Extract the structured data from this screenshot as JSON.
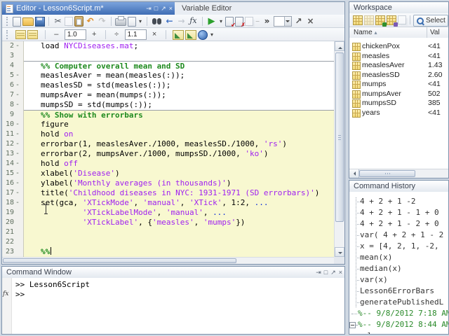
{
  "editor": {
    "title": "Editor - Lesson6Script.m*",
    "variable_editor_tab": "Variable Editor",
    "titlebar_icons": [
      {
        "name": "dock-icon",
        "glyph": "⇥"
      },
      {
        "name": "maximize-icon",
        "glyph": "□"
      },
      {
        "name": "undock-icon",
        "glyph": "↗"
      },
      {
        "name": "close-icon",
        "glyph": "×"
      }
    ],
    "toolbar_main": [
      {
        "name": "new-script-icon",
        "cls": "i-page"
      },
      {
        "name": "open-file-icon",
        "cls": "i-folder"
      },
      {
        "name": "save-icon",
        "cls": "i-disk"
      },
      {
        "name": "sep"
      },
      {
        "name": "cut-icon",
        "cls": "i-glyph",
        "glyph": "✂",
        "color": "#5a6068"
      },
      {
        "name": "copy-icon",
        "cls": "i-copy i-dim"
      },
      {
        "name": "paste-icon",
        "cls": "i-paste"
      },
      {
        "name": "undo-icon",
        "cls": "i-glyph",
        "glyph": "↶",
        "color": "#e08a1e"
      },
      {
        "name": "redo-icon",
        "cls": "i-glyph i-dim",
        "glyph": "↷",
        "color": "#888"
      },
      {
        "name": "sep"
      },
      {
        "name": "print-icon",
        "cls": "i-printer"
      },
      {
        "name": "print-preview-icon",
        "cls": "i-page"
      },
      {
        "name": "print-dropdown-icon",
        "cls": "i-glyph i-tiny",
        "glyph": "▾",
        "color": "#444"
      },
      {
        "name": "sep"
      },
      {
        "name": "find-icon",
        "cls": "i-binoc"
      },
      {
        "name": "go-back-icon",
        "cls": "i-glyph",
        "glyph": "←",
        "color": "#3b6fc4"
      },
      {
        "name": "go-forward-icon",
        "cls": "i-glyph i-dim",
        "glyph": "→",
        "color": "#8a94a2"
      },
      {
        "name": "insert-function-icon",
        "cls": "i-fx",
        "glyph": "ƒx",
        "color": "#3a4450"
      },
      {
        "name": "sep"
      },
      {
        "name": "run-icon",
        "cls": "i-run",
        "glyph": "▶",
        "color": "#2ca02c"
      },
      {
        "name": "run-dropdown-icon",
        "cls": "i-glyph i-tiny",
        "glyph": "▾",
        "color": "#444"
      },
      {
        "name": "save-and-run-icon",
        "cls": "i-page",
        "mark": "↙",
        "markcolor": "#c00"
      },
      {
        "name": "save-run-close-icon",
        "cls": "i-page",
        "mark": "✗",
        "markcolor": "#c00"
      },
      {
        "name": "run-configurations-icon",
        "cls": "i-copy i-dim"
      },
      {
        "name": "collapse-toolbar-icon",
        "cls": "i-glyph i-tiny i-dim",
        "glyph": "−",
        "color": "#777"
      },
      {
        "name": "overflow-chevron-icon",
        "cls": "i-glyph",
        "glyph": "»",
        "color": "#333"
      },
      {
        "name": "document-combo-box",
        "cls": "i-combo"
      },
      {
        "name": "undock-icon",
        "cls": "i-glyph",
        "glyph": "↗",
        "color": "#555"
      },
      {
        "name": "close-icon",
        "cls": "i-glyph",
        "glyph": "×",
        "color": "#555"
      }
    ],
    "toolbar_cell": {
      "icons_left": [
        {
          "name": "insert-cell-break-icon",
          "cls": "i-cell"
        },
        {
          "name": "next-cell-icon",
          "cls": "i-cell"
        }
      ],
      "decrement_label": "–",
      "add_value": "1.0",
      "increment_label": "+",
      "divide_label": "÷",
      "multiply_value": "1.1",
      "multiply_label": "×",
      "icons_right": [
        {
          "name": "evaluate-cell-icon",
          "cls": "i-chart"
        },
        {
          "name": "evaluate-cell-advance-icon",
          "cls": "i-chart"
        },
        {
          "name": "publish-icon",
          "cls": "i-info"
        },
        {
          "name": "publish-dropdown-icon",
          "cls": "i-glyph i-tiny",
          "glyph": "▾",
          "color": "#444"
        }
      ]
    },
    "code_lines": [
      {
        "n": "2",
        "x": 1,
        "c": 0,
        "d": 0,
        "s": [
          [
            "load ",
            "d"
          ],
          [
            "NYCDiseases.mat",
            "s"
          ],
          [
            ";",
            "d"
          ]
        ]
      },
      {
        "n": "3",
        "x": 0,
        "c": 0,
        "d": 0,
        "s": []
      },
      {
        "n": "4",
        "x": 0,
        "c": 0,
        "d": 1,
        "s": [
          [
            "%% Computer overall mean and SD",
            "c"
          ]
        ]
      },
      {
        "n": "5",
        "x": 1,
        "c": 0,
        "d": 0,
        "s": [
          [
            "measlesAver = mean(measles(:));",
            "d"
          ]
        ]
      },
      {
        "n": "6",
        "x": 1,
        "c": 0,
        "d": 0,
        "s": [
          [
            "measlesSD = std(measles(:));",
            "d"
          ]
        ]
      },
      {
        "n": "7",
        "x": 1,
        "c": 0,
        "d": 0,
        "s": [
          [
            "mumpsAver = mean(mumps(:));",
            "d"
          ]
        ]
      },
      {
        "n": "8",
        "x": 1,
        "c": 0,
        "d": 0,
        "s": [
          [
            "mumpsSD = std(mumps(:));",
            "d"
          ]
        ]
      },
      {
        "n": "9",
        "x": 0,
        "c": 1,
        "d": 1,
        "s": [
          [
            "%% Show with errorbars",
            "c"
          ]
        ]
      },
      {
        "n": "10",
        "x": 1,
        "c": 1,
        "d": 0,
        "s": [
          [
            "figure",
            "d"
          ]
        ]
      },
      {
        "n": "11",
        "x": 1,
        "c": 1,
        "d": 0,
        "s": [
          [
            "hold ",
            "d"
          ],
          [
            "on",
            "s"
          ]
        ]
      },
      {
        "n": "12",
        "x": 1,
        "c": 1,
        "d": 0,
        "s": [
          [
            "errorbar(1, measlesAver./1000, measlesSD./1000, ",
            "d"
          ],
          [
            "'rs'",
            "s"
          ],
          [
            ")",
            "d"
          ]
        ]
      },
      {
        "n": "13",
        "x": 1,
        "c": 1,
        "d": 0,
        "s": [
          [
            "errorbar(2, mumpsAver./1000, mumpsSD./1000, ",
            "d"
          ],
          [
            "'ko'",
            "s"
          ],
          [
            ")",
            "d"
          ]
        ]
      },
      {
        "n": "14",
        "x": 1,
        "c": 1,
        "d": 0,
        "s": [
          [
            "hold ",
            "d"
          ],
          [
            "off",
            "s"
          ]
        ]
      },
      {
        "n": "15",
        "x": 1,
        "c": 1,
        "d": 0,
        "s": [
          [
            "xlabel(",
            "d"
          ],
          [
            "'Disease'",
            "s"
          ],
          [
            ")",
            "d"
          ]
        ]
      },
      {
        "n": "16",
        "x": 1,
        "c": 1,
        "d": 0,
        "s": [
          [
            "ylabel(",
            "d"
          ],
          [
            "'Monthly averages (in thousands)'",
            "s"
          ],
          [
            ")",
            "d"
          ]
        ]
      },
      {
        "n": "17",
        "x": 1,
        "c": 1,
        "d": 0,
        "s": [
          [
            "title(",
            "d"
          ],
          [
            "'Childhood diseases in NYC: 1931-1971 (SD errorbars)'",
            "s"
          ],
          [
            ")",
            "d"
          ]
        ]
      },
      {
        "n": "18",
        "x": 1,
        "c": 1,
        "d": 0,
        "s": [
          [
            "set(gca, ",
            "d"
          ],
          [
            "'XTickMode'",
            "s"
          ],
          [
            ", ",
            "d"
          ],
          [
            "'manual'",
            "s"
          ],
          [
            ", ",
            "d"
          ],
          [
            "'XTick'",
            "s"
          ],
          [
            ", 1:2, ",
            "d"
          ],
          [
            "...",
            "k"
          ]
        ]
      },
      {
        "n": "19",
        "x": 0,
        "c": 1,
        "d": 0,
        "s": [
          [
            "         ",
            "d"
          ],
          [
            "'XTickLabelMode'",
            "s"
          ],
          [
            ", ",
            "d"
          ],
          [
            "'manual'",
            "s"
          ],
          [
            ", ",
            "d"
          ],
          [
            "...",
            "k"
          ]
        ]
      },
      {
        "n": "20",
        "x": 0,
        "c": 1,
        "d": 0,
        "s": [
          [
            "         ",
            "d"
          ],
          [
            "'XTickLabel'",
            "s"
          ],
          [
            ", {",
            "d"
          ],
          [
            "'measles'",
            "s"
          ],
          [
            ", ",
            "d"
          ],
          [
            "'mumps'",
            "s"
          ],
          [
            "})",
            "d"
          ]
        ]
      },
      {
        "n": "21",
        "x": 0,
        "c": 1,
        "d": 0,
        "s": []
      },
      {
        "n": "22",
        "x": 0,
        "c": 1,
        "d": 0,
        "s": []
      },
      {
        "n": "23",
        "x": 0,
        "c": 1,
        "d": 0,
        "s": [
          [
            "%%",
            "c"
          ]
        ],
        "caret": 1
      }
    ]
  },
  "command_window": {
    "title": "Command Window",
    "titlebar_icons": [
      {
        "name": "dock-icon",
        "glyph": "⇥"
      },
      {
        "name": "maximize-icon",
        "glyph": "□"
      },
      {
        "name": "undock-icon",
        "glyph": "↗"
      },
      {
        "name": "close-icon",
        "glyph": "×"
      }
    ],
    "lines": [
      {
        "text": ">> Lesson6Script"
      },
      {
        "text": ">>",
        "fx": true
      }
    ],
    "fx_label": "fx"
  },
  "workspace": {
    "title": "Workspace",
    "toolbar_icons": [
      {
        "name": "new-variable-icon",
        "cls": "i-grid"
      },
      {
        "name": "open-selection-icon",
        "cls": "i-grid i-dim"
      },
      {
        "name": "import-data-icon",
        "cls": "i-grid i-imp"
      },
      {
        "name": "update-plot-icon",
        "cls": "i-grid i-pur"
      },
      {
        "name": "delete-variable-icon",
        "cls": "i-copy i-dim"
      },
      {
        "name": "sep"
      }
    ],
    "select_button_label": "Select",
    "columns": {
      "name": "Name",
      "sort_arrow": "▴",
      "value": "Val"
    },
    "rows": [
      {
        "name": "chickenPox",
        "value": "<41"
      },
      {
        "name": "measles",
        "value": "<41"
      },
      {
        "name": "measlesAver",
        "value": "1.43"
      },
      {
        "name": "measlesSD",
        "value": "2.60"
      },
      {
        "name": "mumps",
        "value": "<41"
      },
      {
        "name": "mumpsAver",
        "value": "502"
      },
      {
        "name": "mumpsSD",
        "value": "385"
      },
      {
        "name": "years",
        "value": "<41"
      }
    ]
  },
  "command_history": {
    "title": "Command History",
    "items": [
      {
        "text": "4 + 2 + 1 -2",
        "kind": "cmd"
      },
      {
        "text": "4 + 2 + 1 - 1 + 0",
        "kind": "cmd"
      },
      {
        "text": "4 + 2 + 1 - 2 + 0",
        "kind": "cmd"
      },
      {
        "text": "var( 4 + 2 + 1 - 2",
        "kind": "cmd"
      },
      {
        "text": "x = [4, 2, 1, -2,",
        "kind": "cmd"
      },
      {
        "text": "mean(x)",
        "kind": "cmd"
      },
      {
        "text": "median(x)",
        "kind": "cmd"
      },
      {
        "text": "var(x)",
        "kind": "cmd"
      },
      {
        "text": "Lesson6ErrorBars",
        "kind": "cmd"
      },
      {
        "text": "generatePublishedL",
        "kind": "cmd"
      },
      {
        "text": "%-- 9/8/2012 7:18 AM",
        "kind": "stamp"
      },
      {
        "text": "%-- 9/8/2012 8:44 AM",
        "kind": "stamp",
        "box": true
      },
      {
        "text": "clc",
        "kind": "child"
      }
    ]
  }
}
